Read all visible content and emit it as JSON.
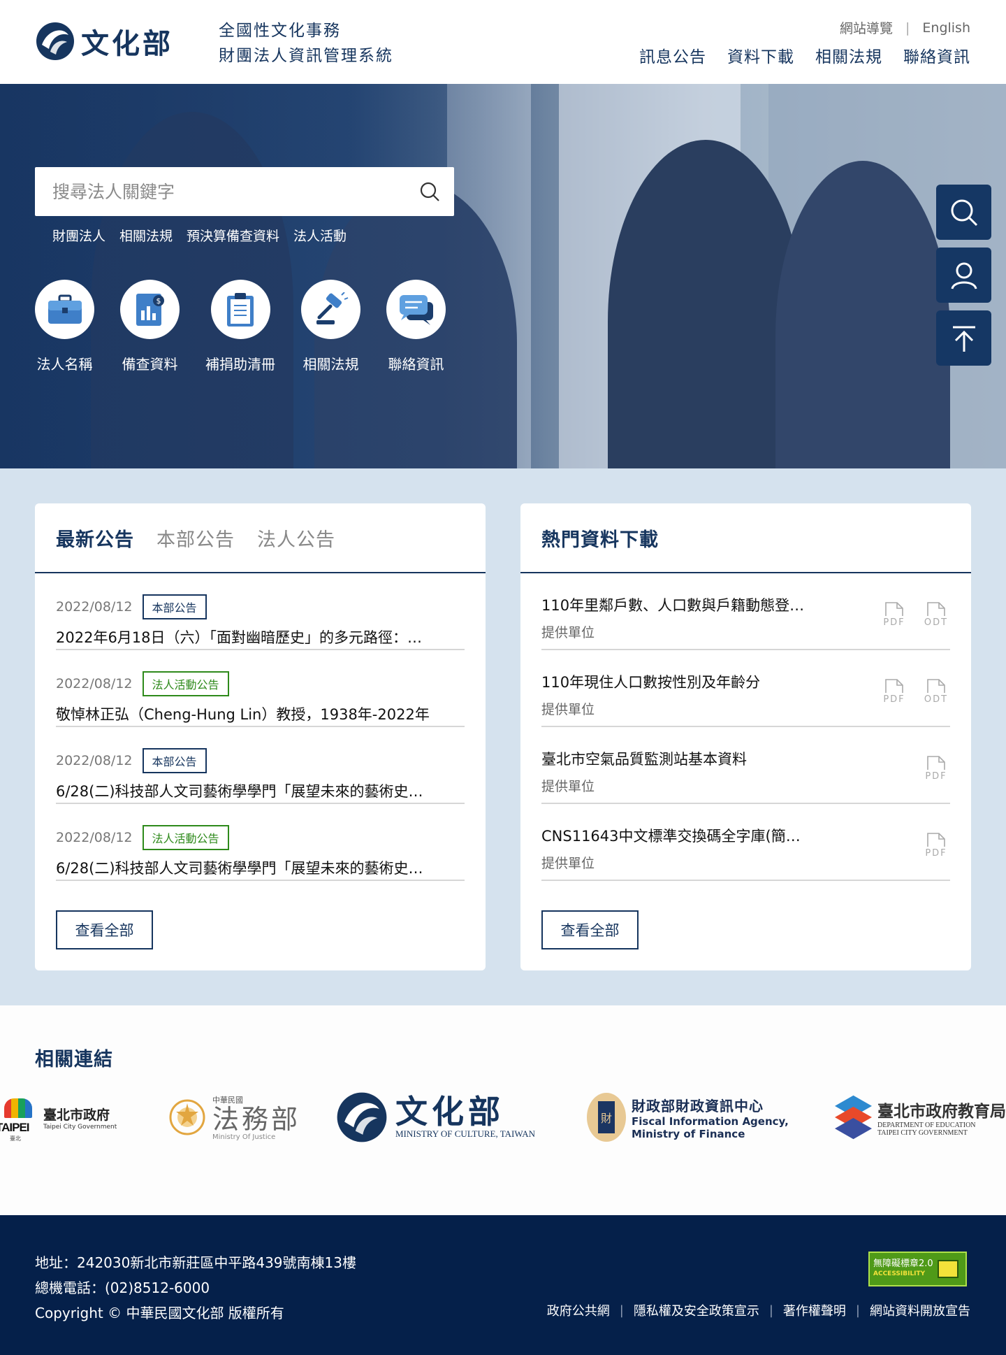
{
  "header": {
    "logo_text": "文化部",
    "system_title_line1": "全國性文化事務",
    "system_title_line2": "財團法人資訊管理系統",
    "utility_links": [
      "網站導覽",
      "English"
    ],
    "nav": [
      "訊息公告",
      "資料下載",
      "相關法規",
      "聯絡資訊"
    ]
  },
  "hero": {
    "search_placeholder": "搜尋法人關鍵字",
    "quick_tags": [
      "財團法人",
      "相關法規",
      "預決算備查資料",
      "法人活動"
    ],
    "shortcuts": [
      {
        "label": "法人名稱",
        "icon": "briefcase-icon"
      },
      {
        "label": "備查資料",
        "icon": "report-document-icon"
      },
      {
        "label": "補捐助清冊",
        "icon": "clipboard-icon"
      },
      {
        "label": "相關法規",
        "icon": "gavel-icon"
      },
      {
        "label": "聯絡資訊",
        "icon": "chat-bubbles-icon"
      }
    ],
    "side_tools": [
      "search-icon",
      "user-icon",
      "back-to-top-icon"
    ]
  },
  "news": {
    "tabs": [
      "最新公告",
      "本部公告",
      "法人公告"
    ],
    "active_tab": "最新公告",
    "items": [
      {
        "date": "2022/08/12",
        "tag": "本部公告",
        "tag_color": "#16355e",
        "title": "2022年6月18日（六）「面對幽暗歷史」的多元路徑：…"
      },
      {
        "date": "2022/08/12",
        "tag": "法人活動公告",
        "tag_color": "#2e8a1b",
        "title": "敬悼林正弘（Cheng-Hung Lin）教授，1938年-2022年"
      },
      {
        "date": "2022/08/12",
        "tag": "本部公告",
        "tag_color": "#16355e",
        "title": "6/28(二)科技部人文司藝術學學門「展望未來的藝術史…"
      },
      {
        "date": "2022/08/12",
        "tag": "法人活動公告",
        "tag_color": "#2e8a1b",
        "title": "6/28(二)科技部人文司藝術學學門「展望未來的藝術史…"
      }
    ],
    "view_all": "查看全部"
  },
  "downloads": {
    "title": "熱門資料下載",
    "items": [
      {
        "title": "110年里鄰戶數、人口數與戶籍動態登…",
        "sub": "提供單位",
        "formats": [
          "PDF",
          "ODT"
        ]
      },
      {
        "title": "110年現住人口數按性別及年齡分",
        "sub": "提供單位",
        "formats": [
          "PDF",
          "ODT"
        ]
      },
      {
        "title": "臺北市空氣品質監測站基本資料",
        "sub": "提供單位",
        "formats": [
          "PDF"
        ]
      },
      {
        "title": "CNS11643中文標準交換碼全字庫(簡…",
        "sub": "提供單位",
        "formats": [
          "PDF"
        ]
      }
    ],
    "view_all": "查看全部"
  },
  "related_links": {
    "title": "相關連結",
    "logos": [
      {
        "name": "臺北市政府",
        "en": "Taipei City Government",
        "mark": "TAIPEI",
        "mark_sub": "臺北"
      },
      {
        "name": "法務部",
        "en": "Ministry Of Justice",
        "pre": "中華民國"
      },
      {
        "name": "文化部",
        "en": "MINISTRY OF CULTURE, TAIWAN"
      },
      {
        "name": "財政部財政資訊中心",
        "en1": "Fiscal Information Agency,",
        "en2": "Ministry of Finance",
        "mark": "財"
      },
      {
        "name": "臺北市政府教育局",
        "en1": "DEPARTMENT OF EDUCATION",
        "en2": "TAIPEI CITY GOVERNMENT"
      }
    ]
  },
  "footer": {
    "address": "地址：242030新北市新莊區中平路439號南棟13樓",
    "phone": "總機電話：(02)8512-6000",
    "copyright": "Copyright © 中華民國文化部 版權所有",
    "a11y_badge_line1": "無障礙標章2.0",
    "a11y_badge_line2": "ACCESSIBILITY",
    "links": [
      "政府公共網",
      "隱私權及安全政策宣示",
      "著作權聲明",
      "網站資料開放宣告"
    ]
  },
  "colors": {
    "primary": "#16355e",
    "green_tag": "#2e8a1b",
    "panel_bg": "#d5e2ee",
    "footer_bg": "#05204a"
  }
}
